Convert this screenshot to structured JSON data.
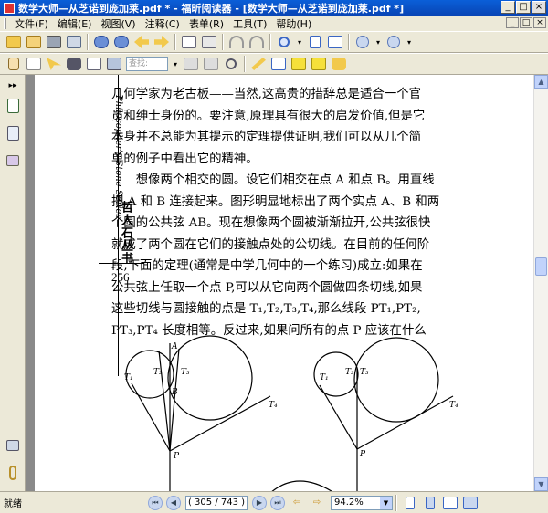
{
  "window": {
    "title": "数学大师—从芝诺到庞加莱.pdf * - 福昕阅读器 - [数学大师—从芝诺到庞加莱.pdf *]",
    "min": "_",
    "max": "□",
    "close": "×"
  },
  "menu": [
    "文件(F)",
    "编辑(E)",
    "视图(V)",
    "注释(C)",
    "表单(R)",
    "工具(T)",
    "帮助(H)"
  ],
  "search": {
    "placeholder": "查找:"
  },
  "status": {
    "text": "就绪",
    "page_display": "( 305 / 743 )",
    "zoom": "94.2%"
  },
  "page": {
    "side_text": "Philosopher's Stone Series",
    "seal_text": "哲人石丛书",
    "number": "256",
    "lines": [
      "几何学家为老古板——当然,这高贵的措辞总是适合一个官",
      "员和绅士身份的。要注意,原理具有很大的启发价值,但是它",
      "本身并不总能为其提示的定理提供证明,我们可以从几个简",
      "单的例子中看出它的精神。",
      "　　想像两个相交的圆。设它们相交在点 A 和点 B。用直线",
      "把 A 和 B 连接起来。图形明显地标出了两个实点 A、B 和两",
      "个圆的公共弦 AB。现在想像两个圆被渐渐拉开,公共弦很快",
      "就成了两个圆在它们的接触点处的公切线。在目前的任何阶",
      "段,下面的定理(通常是中学几何中的一个练习)成立:如果在",
      "公共弦上任取一个点 P,可以从它向两个圆做四条切线,如果",
      "这些切线与圆接触的点是 T₁,T₂,T₃,T₄,那么线段 PT₁,PT₂,",
      "PT₃,PT₄ 长度相等。反过来,如果问所有的点 P 应该在什么"
    ],
    "fig_labels": {
      "A": "A",
      "B": "B",
      "P": "P",
      "T1": "T₁",
      "T2": "T₂",
      "T3": "T₃",
      "T4": "T₄"
    }
  }
}
